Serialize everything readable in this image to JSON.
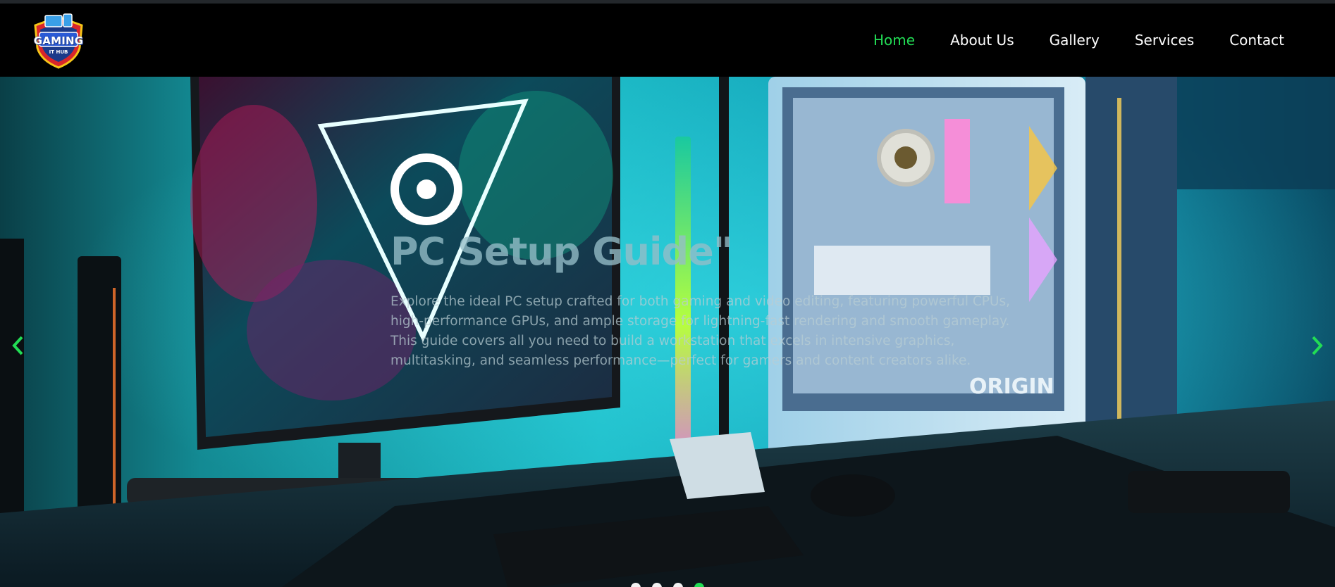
{
  "brand": {
    "logo_text": "GAMING",
    "logo_sub": "IT HUB"
  },
  "nav": {
    "items": [
      {
        "label": "Home",
        "active": true
      },
      {
        "label": "About Us",
        "active": false
      },
      {
        "label": "Gallery",
        "active": false
      },
      {
        "label": "Services",
        "active": false
      },
      {
        "label": "Contact",
        "active": false
      }
    ]
  },
  "hero": {
    "title": "PC Setup Guide\"",
    "description": "Explore the ideal PC setup crafted for both gaming and video editing, featuring powerful CPUs, high-performance GPUs, and ample storage for lightning-fast rendering and smooth gameplay. This guide covers all you need to build a workstation that excels in intensive graphics, multitasking, and seamless performance—perfect for gamers and content creators alike.",
    "case_brand": "ORIGIN",
    "prev_icon": "chevron-left-icon",
    "next_icon": "chevron-right-icon",
    "slides": {
      "count": 4,
      "active": 4
    }
  },
  "colors": {
    "accent": "#22dd55",
    "nav_bg": "#000000",
    "text": "#ffffff",
    "dot_inactive": "#f2f2f2"
  }
}
